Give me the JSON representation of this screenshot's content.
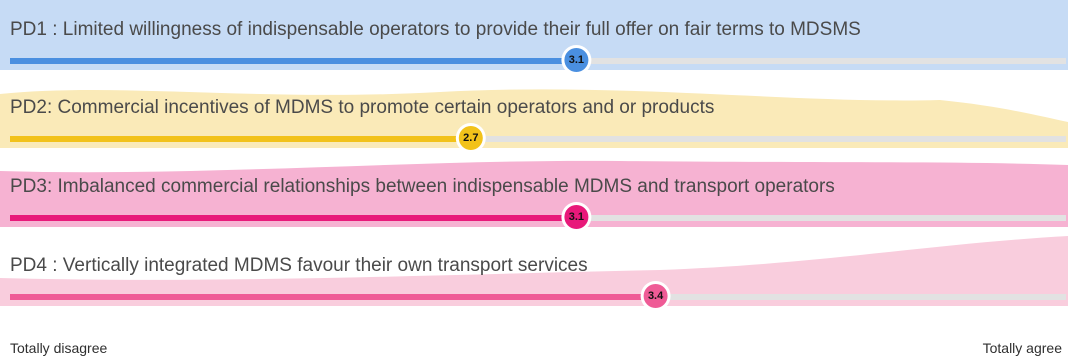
{
  "chart_data": {
    "type": "bar",
    "scale": {
      "min": 1,
      "max": 5
    },
    "axis": {
      "left_label": "Totally disagree",
      "right_label": "Totally agree"
    },
    "items": [
      {
        "label": "PD1 : Limited willingness of indispensable operators to provide their full offer on fair terms to MDSMS",
        "value": 3.1,
        "value_label": "3.1",
        "bar_color": "#4a8fe0",
        "band_color": "#c6dbf5",
        "badge_color": "#4a8fe0",
        "badge_text_color": "#111111"
      },
      {
        "label": "PD2: Commercial incentives of MDMS to promote certain operators and or products",
        "value": 2.7,
        "value_label": "2.7",
        "bar_color": "#f2c21a",
        "band_color": "#faeab8",
        "badge_color": "#f2c21a",
        "badge_text_color": "#111111"
      },
      {
        "label": "PD3: Imbalanced commercial relationships between indispensable MDMS and transport operators",
        "value": 3.1,
        "value_label": "3.1",
        "bar_color": "#e8197a",
        "band_color": "#f6b2d2",
        "badge_color": "#e8197a",
        "badge_text_color": "#111111"
      },
      {
        "label": "PD4 : Vertically integrated MDMS favour their own transport services",
        "value": 3.4,
        "value_label": "3.4",
        "bar_color": "#ef5b96",
        "band_color": "#f9cddd",
        "badge_color": "#ef5b96",
        "badge_text_color": "#111111"
      }
    ]
  }
}
